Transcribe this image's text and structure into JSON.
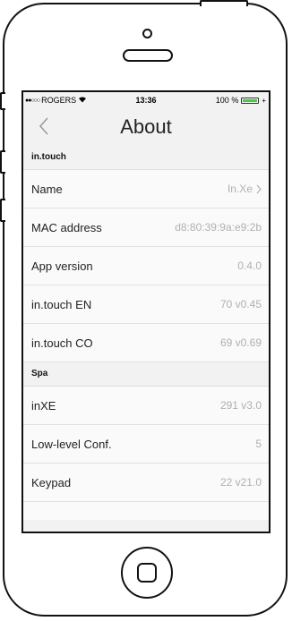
{
  "status_bar": {
    "signal": "●●○○○",
    "carrier": "ROGERS",
    "time": "13:36",
    "battery_text": "100 %",
    "battery_level": 1.0
  },
  "nav": {
    "title": "About"
  },
  "colors": {
    "battery_fill": "#3fcf3f",
    "value_text": "#b0b0b0"
  },
  "sections": [
    {
      "header": "in.touch",
      "rows": [
        {
          "label": "Name",
          "value": "In.Xe"
        },
        {
          "label": "MAC address",
          "value": "d8:80:39:9a:e9:2b"
        },
        {
          "label": "App version",
          "value": "0.4.0"
        },
        {
          "label": "in.touch EN",
          "value": "70 v0.45"
        },
        {
          "label": "in.touch CO",
          "value": "69 v0.69"
        }
      ]
    },
    {
      "header": "Spa",
      "rows": [
        {
          "label": "inXE",
          "value": "291 v3.0"
        },
        {
          "label": "Low-level Conf.",
          "value": "5"
        },
        {
          "label": "Keypad",
          "value": "22 v21.0"
        }
      ]
    }
  ]
}
